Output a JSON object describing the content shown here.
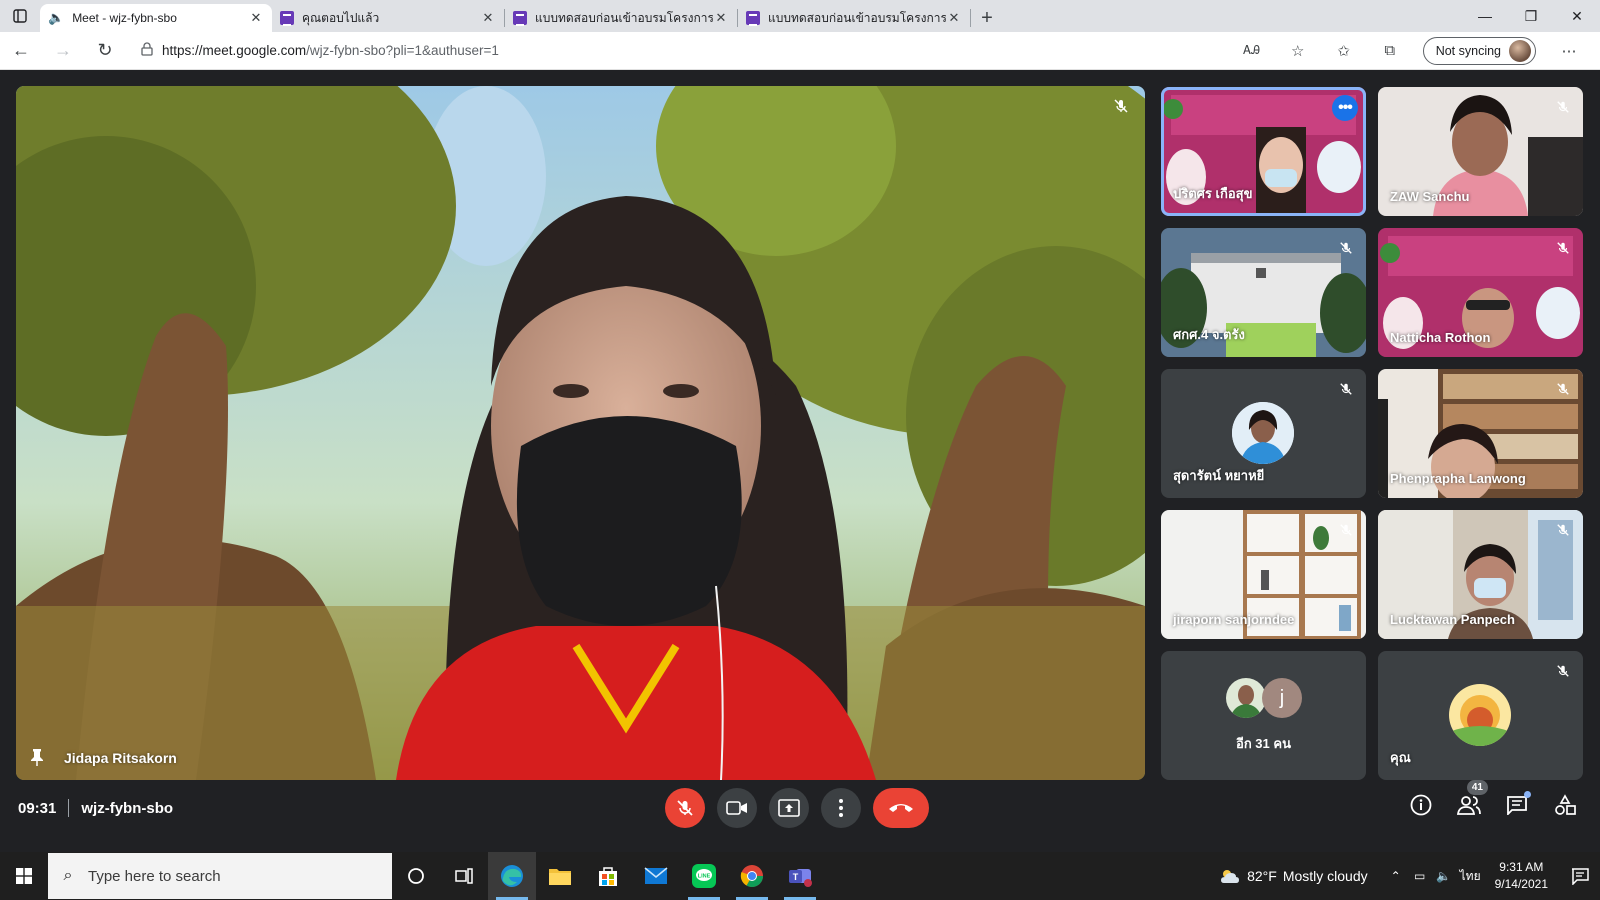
{
  "browser": {
    "tabs": [
      {
        "title": "Meet - wjz-fybn-sbo",
        "active": true,
        "favicon": "meet-icon"
      },
      {
        "title": "คุณตอบไปแล้ว",
        "active": false,
        "favicon": "forms-icon"
      },
      {
        "title": "แบบทดสอบก่อนเข้าอบรมโครงการ \"อบ",
        "active": false,
        "favicon": "forms-icon"
      },
      {
        "title": "แบบทดสอบก่อนเข้าอบรมโครงการ \"อบ",
        "active": false,
        "favicon": "forms-icon"
      }
    ],
    "url_host": "https://meet.google.com",
    "url_path": "/wjz-fybn-sbo?pli=1&authuser=1",
    "sync_label": "Not syncing"
  },
  "meet": {
    "main_speaker": "Jidapa Ritsakorn",
    "tiles": [
      {
        "name": "ปริตศร เกือสุข",
        "muted": false,
        "speaking": true,
        "has_more": true
      },
      {
        "name": "ZAW Sanchu",
        "muted": true
      },
      {
        "name": "ศกศ.4 จ.ตรัง",
        "muted": true
      },
      {
        "name": "Natticha Rothon",
        "muted": true
      },
      {
        "name": "สุดารัตน์ หยาหยี",
        "muted": true
      },
      {
        "name": "Phenprapha Lanwong",
        "muted": true
      },
      {
        "name": "jiraporn sanjorndee",
        "muted": true
      },
      {
        "name": "Lucktawan Panpech",
        "muted": true
      },
      {
        "name": "อีก 31 คน",
        "avatar_letter": "j"
      },
      {
        "name": "คุณ",
        "muted": true
      }
    ],
    "time": "09:31",
    "meeting_code": "wjz-fybn-sbo",
    "participant_count": "41",
    "colors": {
      "accent": "#8ab4f8",
      "danger": "#ea4335",
      "bg": "#202124"
    }
  },
  "taskbar": {
    "search_placeholder": "Type here to search",
    "weather_temp": "82°F",
    "weather_text": "Mostly cloudy",
    "lang": "ไทย",
    "time": "9:31 AM",
    "date": "9/14/2021"
  }
}
